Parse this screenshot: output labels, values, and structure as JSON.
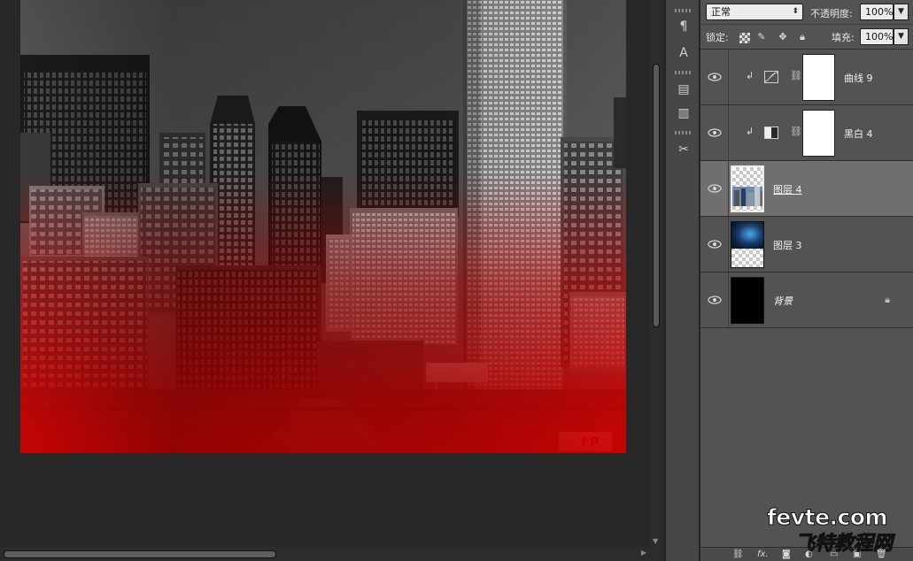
{
  "options": {
    "blend_mode": "正常",
    "opacity_label": "不透明度:",
    "opacity_value": "100%",
    "lock_label": "锁定:",
    "fill_label": "填充:",
    "fill_value": "100%"
  },
  "layers": [
    {
      "name": "曲线 9",
      "kind": "adjustment",
      "icon": "curves-icon",
      "clipped": true,
      "visible": true
    },
    {
      "name": "黑白 4",
      "kind": "adjustment",
      "icon": "black-white-icon",
      "clipped": true,
      "visible": true
    },
    {
      "name": "图层 4",
      "kind": "pixel",
      "thumbnail": "city-photo",
      "selected": true,
      "visible": true
    },
    {
      "name": "图层 3",
      "kind": "pixel",
      "thumbnail": "blue-cloud",
      "visible": true
    },
    {
      "name": "背景",
      "kind": "background",
      "thumbnail": "black-fill",
      "locked": true,
      "visible": true
    }
  ],
  "canvas": {
    "description_visible": false,
    "brand_sign_text": "↑P"
  },
  "watermark": {
    "line1": "fevte.com",
    "line2": "飞特教程网"
  },
  "colors": {
    "panel": "#535353",
    "selected_layer": "#6f6f6f",
    "canvas_bg": "#282828",
    "red_tint": "#d10000"
  }
}
